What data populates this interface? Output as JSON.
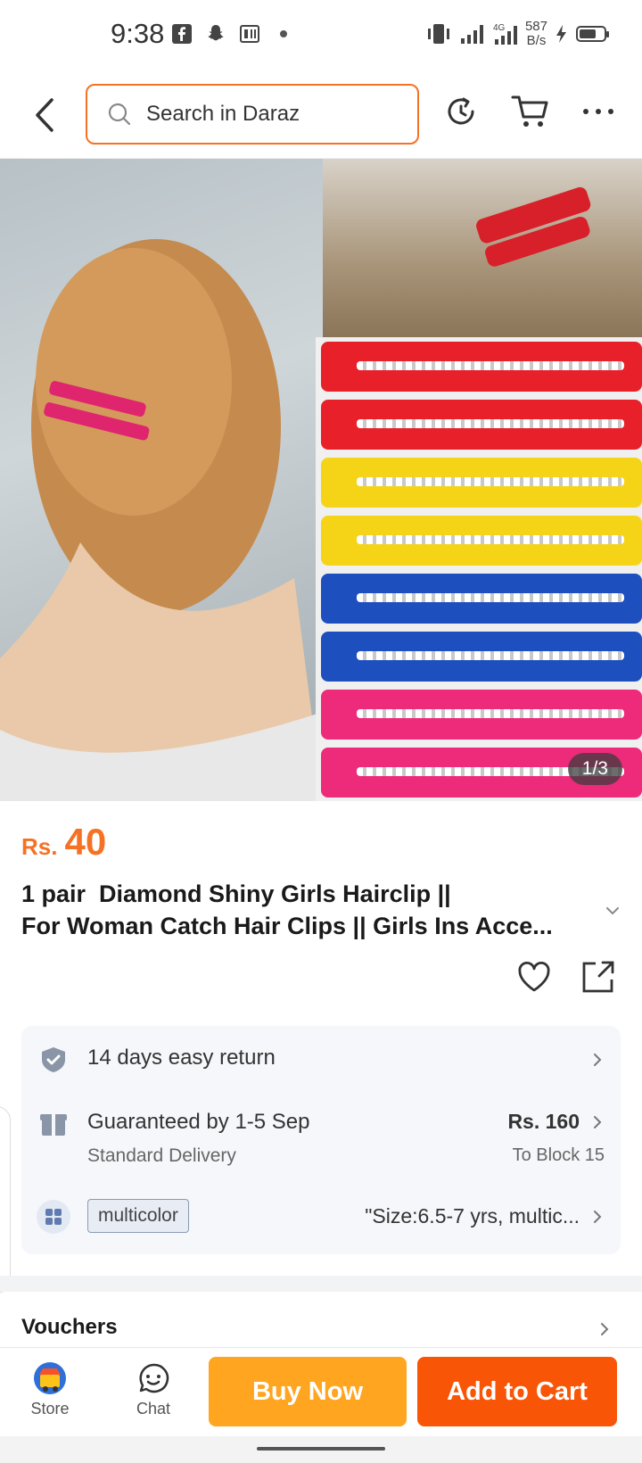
{
  "status_bar": {
    "time": "9:38",
    "net_speed_value": "587",
    "net_speed_unit": "B/s",
    "network": "4G",
    "battery_level": 0.7
  },
  "header": {
    "search_placeholder": "Search in Daraz"
  },
  "gallery": {
    "page_indicator": "1/3",
    "clip_colors": [
      "#e8202a",
      "#e8202a",
      "#f5d418",
      "#f5d418",
      "#1e4fbf",
      "#1e4fbf",
      "#ee2a7b",
      "#ee2a7b"
    ]
  },
  "product": {
    "price_currency": "Rs.",
    "price_amount": "40",
    "title_line1": "1 pair  Diamond Shiny Girls Hairclip ||",
    "title_line2": "For Woman Catch Hair Clips || Girls Ins Acce..."
  },
  "info": {
    "return_text": "14 days easy return",
    "delivery_text": "Guaranteed by 1-5 Sep",
    "delivery_sub": "Standard Delivery",
    "delivery_price": "Rs. 160",
    "delivery_location": "To Block 15",
    "variant_tag": "multicolor",
    "variant_text": "\"Size:6.5-7 yrs, multic..."
  },
  "vouchers": {
    "label": "Vouchers"
  },
  "bottom_bar": {
    "store_label": "Store",
    "chat_label": "Chat",
    "buy_now_label": "Buy Now",
    "add_to_cart_label": "Add to Cart"
  },
  "colors": {
    "accent": "#f57224",
    "buy_now": "#ffa51f",
    "add_to_cart": "#f85606"
  }
}
